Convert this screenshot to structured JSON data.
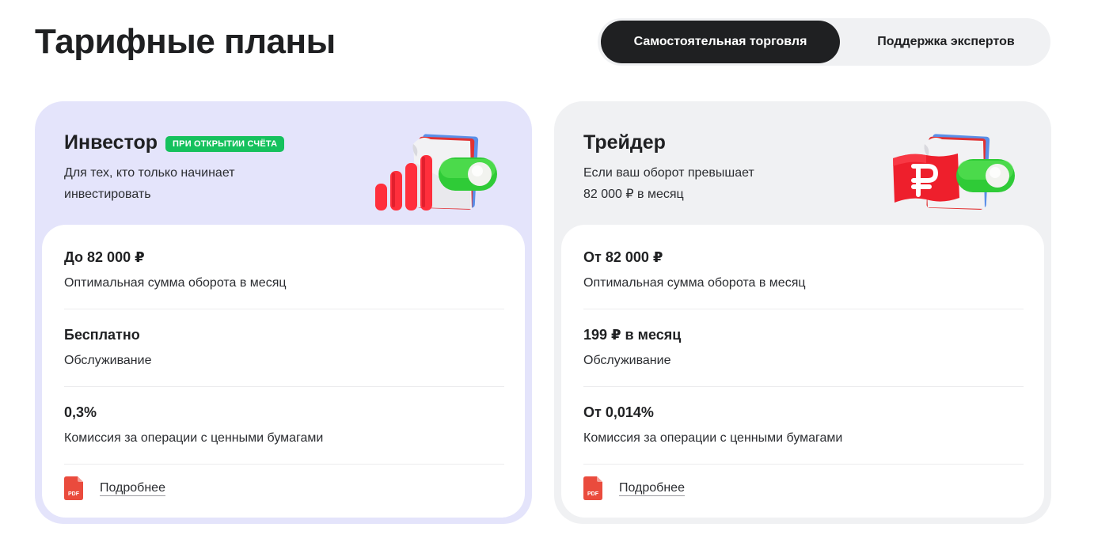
{
  "page": {
    "title": "Тарифные планы"
  },
  "switcher": {
    "tabs": [
      {
        "label": "Самостоятельная торговля",
        "active": true
      },
      {
        "label": "Поддержка экспертов",
        "active": false
      }
    ]
  },
  "colors": {
    "accent_dark": "#1f2022",
    "badge_green": "#15c15d",
    "investor_bg": "#e4e4fb",
    "trader_bg": "#f0f1f3",
    "brand_red": "#ef2131",
    "toggle_green": "#30d13a"
  },
  "cards": [
    {
      "title": "Инвестор",
      "badge": "ПРИ ОТКРЫТИИ СЧЁТА",
      "subtitle_line1": "Для тех, кто только начинает",
      "subtitle_line2": "инвестировать",
      "illustration": "bar-chart-toggle-icon",
      "rows": [
        {
          "value": "До 82 000 ₽",
          "label": "Оптимальная сумма оборота в месяц"
        },
        {
          "value": "Бесплатно",
          "label": "Обслуживание"
        },
        {
          "value": "0,3%",
          "label": "Комиссия за операции с ценными бумагами"
        }
      ],
      "details": {
        "icon": "pdf-icon",
        "icon_text": "PDF",
        "label": "Подробнее"
      }
    },
    {
      "title": "Трейдер",
      "subtitle_line1": "Если ваш оборот превышает",
      "subtitle_line2": "82 000 ₽ в месяц",
      "illustration": "ruble-flag-toggle-icon",
      "rows": [
        {
          "value": "От 82 000 ₽",
          "label": "Оптимальная сумма оборота в месяц"
        },
        {
          "value": "199 ₽ в месяц",
          "label": "Обслуживание"
        },
        {
          "value": "От 0,014%",
          "label": "Комиссия за операции с ценными бумагами"
        }
      ],
      "details": {
        "icon": "pdf-icon",
        "icon_text": "PDF",
        "label": "Подробнее"
      }
    }
  ]
}
